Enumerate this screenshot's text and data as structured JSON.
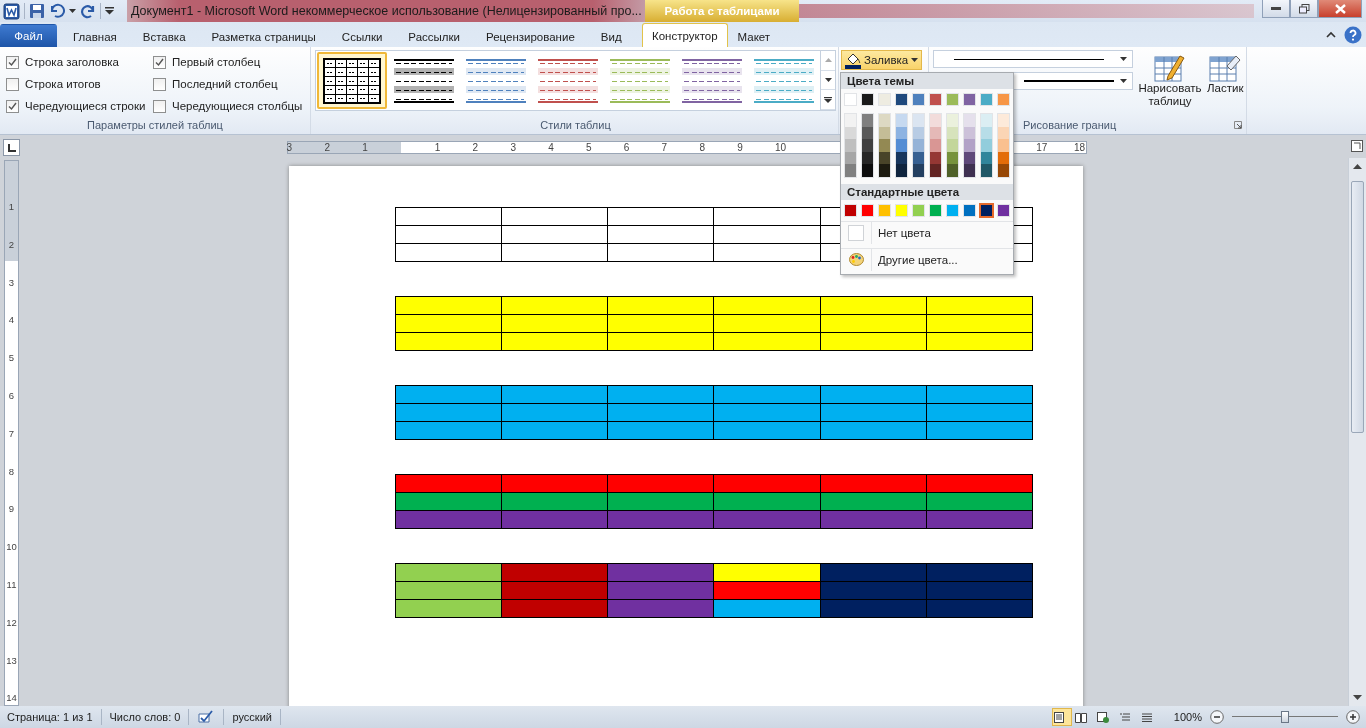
{
  "title_bar": {
    "title": "Документ1  -  Microsoft Word некоммерческое использование (Нелицензированный про...",
    "context_tab": "Работа с таблицами"
  },
  "tabs": [
    {
      "label": "Файл",
      "kind": "file",
      "selected": false
    },
    {
      "label": "Главная",
      "kind": "tab",
      "selected": false
    },
    {
      "label": "Вставка",
      "kind": "tab",
      "selected": false
    },
    {
      "label": "Разметка страницы",
      "kind": "tab",
      "selected": false
    },
    {
      "label": "Ссылки",
      "kind": "tab",
      "selected": false
    },
    {
      "label": "Рассылки",
      "kind": "tab",
      "selected": false
    },
    {
      "label": "Рецензирование",
      "kind": "tab",
      "selected": false
    },
    {
      "label": "Вид",
      "kind": "tab",
      "selected": false
    },
    {
      "label": "Конструктор",
      "kind": "context",
      "selected": true
    },
    {
      "label": "Макет",
      "kind": "context",
      "selected": false
    }
  ],
  "style_options": {
    "label": "Параметры стилей таблиц",
    "items": [
      {
        "label": "Строка заголовка",
        "checked": true
      },
      {
        "label": "Строка итогов",
        "checked": false
      },
      {
        "label": "Чередующиеся строки",
        "checked": true
      },
      {
        "label": "Первый столбец",
        "checked": true
      },
      {
        "label": "Последний столбец",
        "checked": false
      },
      {
        "label": "Чередующиеся столбцы",
        "checked": false
      }
    ]
  },
  "table_styles": {
    "label": "Стили таблиц",
    "items": [
      {
        "kind": "grid",
        "color": "#000000",
        "selected": true
      },
      {
        "kind": "banded",
        "color": "#000000",
        "selected": false
      },
      {
        "kind": "banded",
        "color": "#4f81bd",
        "selected": false
      },
      {
        "kind": "banded",
        "color": "#c0504d",
        "selected": false
      },
      {
        "kind": "banded",
        "color": "#9bbb59",
        "selected": false
      },
      {
        "kind": "banded",
        "color": "#8064a2",
        "selected": false
      },
      {
        "kind": "banded",
        "color": "#4bacc6",
        "selected": false
      }
    ]
  },
  "shading_button": {
    "label": "Заливка",
    "pressed": true
  },
  "borders": {
    "label": "Рисование границ",
    "draw_table": "Нарисовать таблицу",
    "eraser": "Ластик"
  },
  "ruler": {
    "before": [
      "3",
      "2",
      "1"
    ],
    "after": [
      "1",
      "2",
      "3",
      "4",
      "5",
      "6",
      "7",
      "8",
      "9",
      "10"
    ],
    "end": [
      "17",
      "18"
    ],
    "vertical": [
      "1",
      "2",
      "3",
      "4",
      "5",
      "6",
      "7",
      "8",
      "9",
      "10",
      "11",
      "12",
      "13",
      "14"
    ]
  },
  "tables": [
    {
      "rows": [
        {
          "cells": [
            {
              "color": "#ffffff"
            },
            {
              "color": "#ffffff"
            },
            {
              "color": "#ffffff"
            },
            {
              "color": "#ffffff"
            },
            {
              "color": "#ffffff"
            },
            {
              "color": "#ffffff"
            }
          ]
        },
        {
          "cells": [
            {
              "color": "#ffffff"
            },
            {
              "color": "#ffffff"
            },
            {
              "color": "#ffffff"
            },
            {
              "color": "#ffffff"
            },
            {
              "color": "#ffffff"
            },
            {
              "color": "#ffffff"
            }
          ]
        },
        {
          "cells": [
            {
              "color": "#ffffff"
            },
            {
              "color": "#ffffff"
            },
            {
              "color": "#ffffff"
            },
            {
              "color": "#ffffff"
            },
            {
              "color": "#ffffff"
            },
            {
              "color": "#ffffff"
            }
          ]
        }
      ]
    },
    {
      "rows": [
        {
          "cells": [
            {
              "color": "#ffff00"
            },
            {
              "color": "#ffff00"
            },
            {
              "color": "#ffff00"
            },
            {
              "color": "#ffff00"
            },
            {
              "color": "#ffff00"
            },
            {
              "color": "#ffff00"
            }
          ]
        },
        {
          "cells": [
            {
              "color": "#ffff00"
            },
            {
              "color": "#ffff00"
            },
            {
              "color": "#ffff00"
            },
            {
              "color": "#ffff00"
            },
            {
              "color": "#ffff00"
            },
            {
              "color": "#ffff00"
            }
          ]
        },
        {
          "cells": [
            {
              "color": "#ffff00"
            },
            {
              "color": "#ffff00"
            },
            {
              "color": "#ffff00"
            },
            {
              "color": "#ffff00"
            },
            {
              "color": "#ffff00"
            },
            {
              "color": "#ffff00"
            }
          ]
        }
      ]
    },
    {
      "rows": [
        {
          "cells": [
            {
              "color": "#00b0f0"
            },
            {
              "color": "#00b0f0"
            },
            {
              "color": "#00b0f0"
            },
            {
              "color": "#00b0f0"
            },
            {
              "color": "#00b0f0"
            },
            {
              "color": "#00b0f0"
            }
          ]
        },
        {
          "cells": [
            {
              "color": "#00b0f0"
            },
            {
              "color": "#00b0f0"
            },
            {
              "color": "#00b0f0"
            },
            {
              "color": "#00b0f0"
            },
            {
              "color": "#00b0f0"
            },
            {
              "color": "#00b0f0"
            }
          ]
        },
        {
          "cells": [
            {
              "color": "#00b0f0"
            },
            {
              "color": "#00b0f0"
            },
            {
              "color": "#00b0f0"
            },
            {
              "color": "#00b0f0"
            },
            {
              "color": "#00b0f0"
            },
            {
              "color": "#00b0f0"
            }
          ]
        }
      ]
    },
    {
      "rows": [
        {
          "cells": [
            {
              "color": "#ff0000"
            },
            {
              "color": "#ff0000"
            },
            {
              "color": "#ff0000"
            },
            {
              "color": "#ff0000"
            },
            {
              "color": "#ff0000"
            },
            {
              "color": "#ff0000"
            }
          ]
        },
        {
          "cells": [
            {
              "color": "#00b050"
            },
            {
              "color": "#00b050"
            },
            {
              "color": "#00b050"
            },
            {
              "color": "#00b050"
            },
            {
              "color": "#00b050"
            },
            {
              "color": "#00b050"
            }
          ]
        },
        {
          "cells": [
            {
              "color": "#7030a0"
            },
            {
              "color": "#7030a0"
            },
            {
              "color": "#7030a0"
            },
            {
              "color": "#7030a0"
            },
            {
              "color": "#7030a0"
            },
            {
              "color": "#7030a0"
            }
          ]
        }
      ]
    },
    {
      "rows": [
        {
          "cells": [
            {
              "color": "#92d050"
            },
            {
              "color": "#c00000"
            },
            {
              "color": "#7030a0"
            },
            {
              "color": "#ffff00"
            },
            {
              "color": "#002060"
            },
            {
              "color": "#002060"
            }
          ]
        },
        {
          "cells": [
            {
              "color": "#92d050"
            },
            {
              "color": "#c00000"
            },
            {
              "color": "#7030a0"
            },
            {
              "color": "#ff0000"
            },
            {
              "color": "#002060"
            },
            {
              "color": "#002060"
            }
          ]
        },
        {
          "cells": [
            {
              "color": "#92d050"
            },
            {
              "color": "#c00000"
            },
            {
              "color": "#7030a0"
            },
            {
              "color": "#00b0f0"
            },
            {
              "color": "#002060"
            },
            {
              "color": "#002060"
            }
          ]
        }
      ]
    }
  ],
  "shading_menu": {
    "theme_heading": "Цвета темы",
    "theme_colors": [
      {
        "color": "#ffffff",
        "shades": [
          {
            "color": "#f2f2f2"
          },
          {
            "color": "#d9d9d9"
          },
          {
            "color": "#bfbfbf"
          },
          {
            "color": "#a6a6a6"
          },
          {
            "color": "#808080"
          }
        ]
      },
      {
        "color": "#1a1a1a",
        "shades": [
          {
            "color": "#7f7f7f"
          },
          {
            "color": "#595959"
          },
          {
            "color": "#404040"
          },
          {
            "color": "#262626"
          },
          {
            "color": "#0d0d0d"
          }
        ]
      },
      {
        "color": "#eeece1",
        "shades": [
          {
            "color": "#ddd9c3"
          },
          {
            "color": "#c4bd97"
          },
          {
            "color": "#938953"
          },
          {
            "color": "#494429"
          },
          {
            "color": "#1d1b10"
          }
        ]
      },
      {
        "color": "#1f497d",
        "shades": [
          {
            "color": "#c6d9f0"
          },
          {
            "color": "#8db3e2"
          },
          {
            "color": "#548dd4"
          },
          {
            "color": "#17365d"
          },
          {
            "color": "#0f243e"
          }
        ]
      },
      {
        "color": "#4f81bd",
        "shades": [
          {
            "color": "#dbe5f1"
          },
          {
            "color": "#b8cce4"
          },
          {
            "color": "#95b3d7"
          },
          {
            "color": "#366092"
          },
          {
            "color": "#244061"
          }
        ]
      },
      {
        "color": "#c0504d",
        "shades": [
          {
            "color": "#f2dcdb"
          },
          {
            "color": "#e5b9b7"
          },
          {
            "color": "#d99694"
          },
          {
            "color": "#953734"
          },
          {
            "color": "#632423"
          }
        ]
      },
      {
        "color": "#9bbb59",
        "shades": [
          {
            "color": "#ebf1dd"
          },
          {
            "color": "#d7e3bc"
          },
          {
            "color": "#c3d69b"
          },
          {
            "color": "#76923c"
          },
          {
            "color": "#4f6128"
          }
        ]
      },
      {
        "color": "#8064a2",
        "shades": [
          {
            "color": "#e5e0ec"
          },
          {
            "color": "#ccc1d9"
          },
          {
            "color": "#b2a2c7"
          },
          {
            "color": "#5f497a"
          },
          {
            "color": "#3f3151"
          }
        ]
      },
      {
        "color": "#4bacc6",
        "shades": [
          {
            "color": "#dbeef3"
          },
          {
            "color": "#b7dde8"
          },
          {
            "color": "#92cddc"
          },
          {
            "color": "#31859b"
          },
          {
            "color": "#205867"
          }
        ]
      },
      {
        "color": "#f79646",
        "shades": [
          {
            "color": "#fdeada"
          },
          {
            "color": "#fbd5b5"
          },
          {
            "color": "#fac08f"
          },
          {
            "color": "#e36c09"
          },
          {
            "color": "#974806"
          }
        ]
      }
    ],
    "standard_heading": "Стандартные цвета",
    "standard_colors": [
      {
        "color": "#c00000",
        "selected": false
      },
      {
        "color": "#ff0000",
        "selected": false
      },
      {
        "color": "#ffc000",
        "selected": false
      },
      {
        "color": "#ffff00",
        "selected": false
      },
      {
        "color": "#92d050",
        "selected": false
      },
      {
        "color": "#00b050",
        "selected": false
      },
      {
        "color": "#00b0f0",
        "selected": false
      },
      {
        "color": "#0070c0",
        "selected": false
      },
      {
        "color": "#002060",
        "selected": true
      },
      {
        "color": "#7030a0",
        "selected": false
      }
    ],
    "no_color": "Нет цвета",
    "more_colors": "Другие цвета..."
  },
  "status_bar": {
    "page": "Страница: 1 из 1",
    "words": "Число слов: 0",
    "language": "русский",
    "views": [
      {
        "kind": "print",
        "selected": true
      },
      {
        "kind": "reading",
        "selected": false
      },
      {
        "kind": "web",
        "selected": false
      },
      {
        "kind": "outline",
        "selected": false
      },
      {
        "kind": "draft",
        "selected": false
      }
    ],
    "zoom": "100%",
    "zoom_slider": {
      "level": 0.5
    }
  }
}
